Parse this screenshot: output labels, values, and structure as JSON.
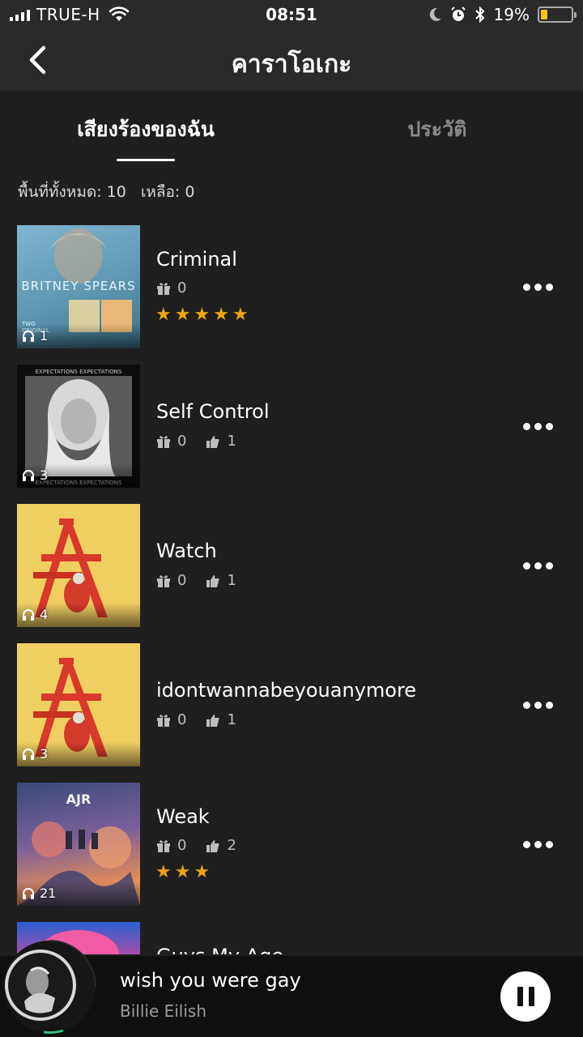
{
  "status_bar": {
    "carrier": "TRUE-H",
    "time": "08:51",
    "battery": "19%",
    "icons": [
      "signal-icon",
      "wifi-icon",
      "moon-icon",
      "alarm-icon",
      "bluetooth-icon",
      "battery-icon"
    ]
  },
  "nav": {
    "title": "คาราโอเกะ",
    "back_icon": "chevron-left-icon"
  },
  "tabs": [
    {
      "label": "เสียงร้องของฉัน",
      "active": true
    },
    {
      "label": "ประวัติ",
      "active": false
    }
  ],
  "storage": {
    "total": "พื้นที่ทั้งหมด: 10",
    "remaining": "เหลือ: 0"
  },
  "songs": [
    {
      "title": "Criminal",
      "plays": "1",
      "gifts": "0",
      "likes": null,
      "stars": 5,
      "cover_art": "britney"
    },
    {
      "title": "Self Control",
      "plays": "3",
      "gifts": "0",
      "likes": "1",
      "stars": 0,
      "cover_art": "expectations"
    },
    {
      "title": "Watch",
      "plays": "4",
      "gifts": "0",
      "likes": "1",
      "stars": 0,
      "cover_art": "billie"
    },
    {
      "title": "idontwannabeyouanymore",
      "plays": "3",
      "gifts": "0",
      "likes": "1",
      "stars": 0,
      "cover_art": "billie"
    },
    {
      "title": "Weak",
      "plays": "21",
      "gifts": "0",
      "likes": "2",
      "stars": 3,
      "cover_art": "ajr"
    },
    {
      "title": "Guys My Age",
      "plays": "",
      "gifts": "",
      "likes": null,
      "stars": 0,
      "cover_art": "pink"
    }
  ],
  "now_playing": {
    "title": "wish you were gay",
    "artist": "Billie Eilish",
    "state_icon": "pause-icon"
  },
  "colors": {
    "background": "#1f1f1f",
    "bar": "#2a2a2a",
    "star": "#e9a514",
    "player_bg": "#0f0f0f"
  }
}
